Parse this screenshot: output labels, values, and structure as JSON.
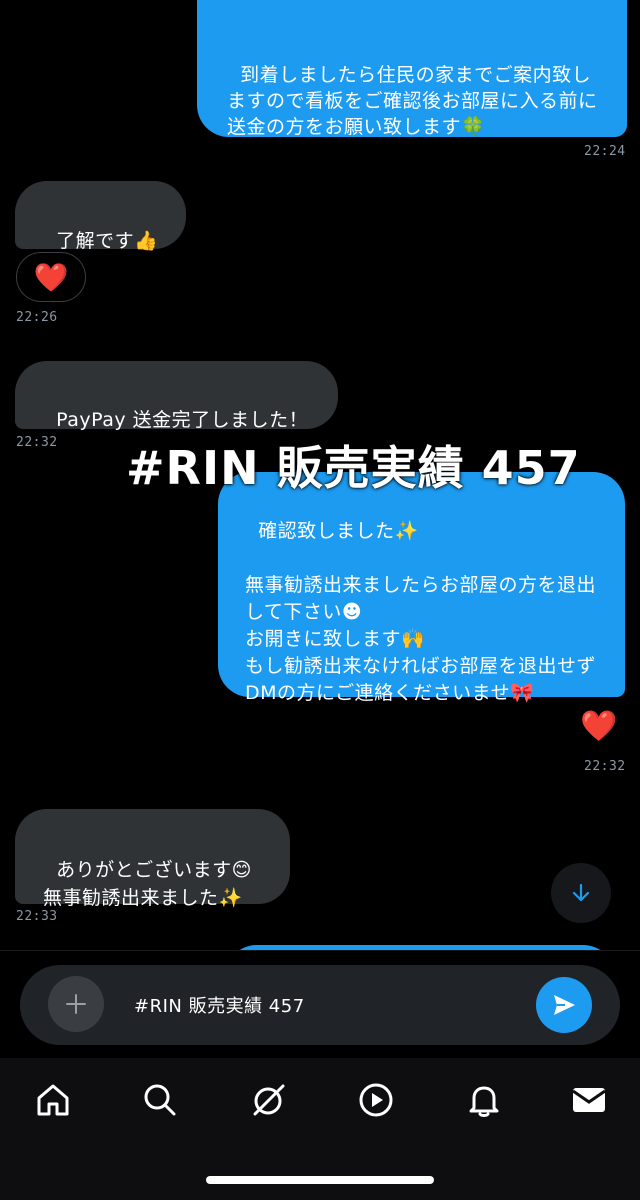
{
  "messages": [
    {
      "id": "m1",
      "side": "out",
      "text": "到着しましたら住民の家までご案内致しますので看板をご確認後お部屋に入る前に送金の方をお願い致します🍀",
      "time": "22:24"
    },
    {
      "id": "m2",
      "side": "in",
      "text": "了解です👍",
      "reaction": "❤️",
      "time": "22:26"
    },
    {
      "id": "m3",
      "side": "in",
      "text": "PayPay 送金完了しました！",
      "time": "22:32"
    },
    {
      "id": "m4",
      "side": "out",
      "text": "確認致しました✨\n\n無事勧誘出来ましたらお部屋の方を退出して下さい☻\nお開きに致します🙌\nもし勧誘出来なければお部屋を退出せずDMの方にご連絡くださいませ🎀",
      "reaction": "❤️",
      "time": "22:32"
    },
    {
      "id": "m5",
      "side": "in",
      "text": "ありがとございます😊\n無事勧誘出来ました✨",
      "time": "22:33"
    }
  ],
  "overlay_caption": "#RIN 販売実績 457",
  "composer": {
    "value": "#RIN 販売実績 457"
  },
  "icons": {
    "scroll": "arrow-down-icon",
    "add": "plus-icon",
    "send": "send-icon",
    "tabs": [
      "home-icon",
      "search-icon",
      "grok-icon",
      "play-icon",
      "bell-icon",
      "mail-icon"
    ]
  },
  "colors": {
    "outgoing_bubble": "#1d9bf0",
    "incoming_bubble": "#2f3336",
    "background": "#000000",
    "timestamp": "#8b98a5"
  }
}
